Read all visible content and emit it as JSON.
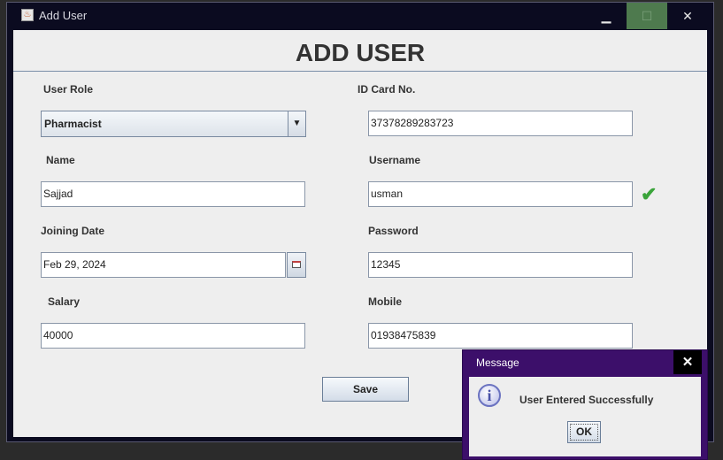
{
  "window": {
    "title": "Add User",
    "controls": {
      "minimize": "▁",
      "maximize": "☐",
      "close": "✕"
    }
  },
  "form": {
    "heading": "ADD USER",
    "labels": {
      "user_role": "User Role",
      "id_card": "ID Card No.",
      "name": "Name",
      "username": "Username",
      "joining_date": "Joining Date",
      "password": "Password",
      "salary": "Salary",
      "mobile": "Mobile"
    },
    "values": {
      "user_role": "Pharmacist",
      "id_card": "37378289283723",
      "name": "Sajjad",
      "username": "usman",
      "joining_date": "Feb 29, 2024",
      "password": "12345",
      "salary": "40000",
      "mobile": "01938475839"
    },
    "username_status_icon": "check-icon",
    "save_label": "Save"
  },
  "dialog": {
    "title": "Message",
    "close": "✕",
    "icon": "info-icon",
    "icon_glyph": "i",
    "message": "User Entered Successfully",
    "ok_label": "OK"
  },
  "colors": {
    "title_bar": "#0b0b20",
    "form_bg": "#eeeeee",
    "dialog_frame": "#3c0f6a",
    "check": "#3aa43a"
  }
}
